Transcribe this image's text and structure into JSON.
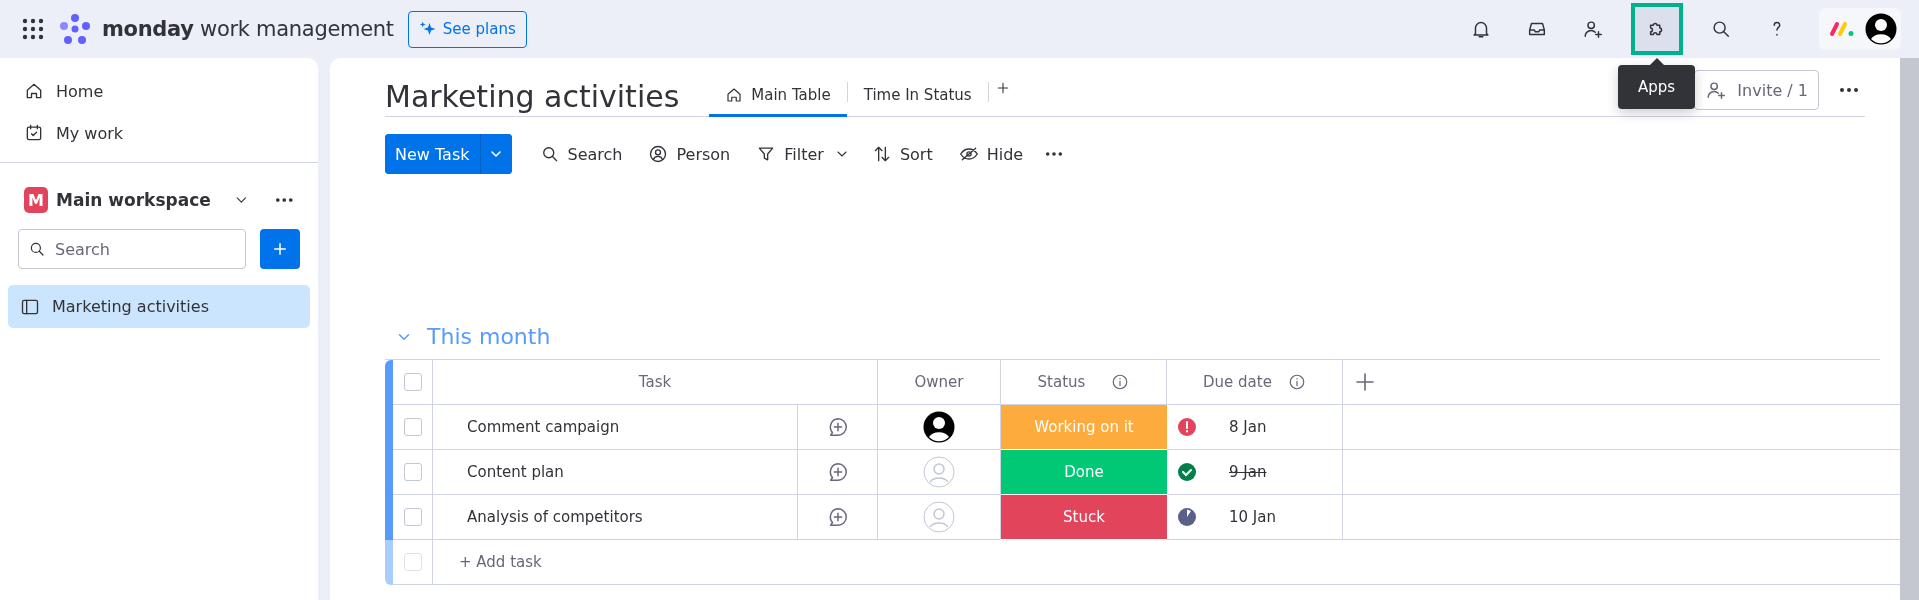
{
  "topbar": {
    "brand_bold": "monday",
    "brand_rest": "work management",
    "plans_button": "See plans",
    "icons": [
      {
        "kind": "bell",
        "selected": false
      },
      {
        "kind": "inbox",
        "selected": false
      },
      {
        "kind": "invite",
        "selected": false
      },
      {
        "kind": "apps",
        "selected": true
      },
      {
        "kind": "search",
        "selected": false
      },
      {
        "kind": "help",
        "selected": false
      }
    ],
    "tooltip": "Apps"
  },
  "sidebar": {
    "items": [
      {
        "label": "Home",
        "kind": "home"
      },
      {
        "label": "My work",
        "kind": "calendar"
      }
    ],
    "workspace": {
      "name": "Main workspace",
      "initial": "M"
    },
    "search": {
      "placeholder": "Search"
    },
    "boards": [
      {
        "label": "Marketing activities",
        "selected": true
      }
    ]
  },
  "board": {
    "title": "Marketing activities",
    "views": [
      {
        "label": "Main Table",
        "selected": true,
        "kind": "home"
      },
      {
        "label": "Time In Status",
        "selected": false,
        "kind": "plain"
      }
    ],
    "invite": "Invite / 1",
    "new_task": "New Task",
    "tools": [
      {
        "label": "Search",
        "kind": "search"
      },
      {
        "label": "Person",
        "kind": "person"
      },
      {
        "label": "Filter",
        "kind": "filter"
      },
      {
        "label": "Sort",
        "kind": "sort"
      },
      {
        "label": "Hide",
        "kind": "hide"
      }
    ],
    "group": {
      "title": "This month",
      "expanded": true,
      "select_all": {
        "checked": false
      },
      "columns": [
        "Task",
        "Owner",
        "Status",
        "Due date"
      ],
      "rows": [
        {
          "task": "Comment campaign",
          "checked": false,
          "assigned": true,
          "status": {
            "label": "Working on it",
            "color": "#fdab3d"
          },
          "due": {
            "text": "8 Jan",
            "kind": "overdue"
          }
        },
        {
          "task": "Content plan",
          "checked": false,
          "assigned": false,
          "status": {
            "label": "Done",
            "color": "#00c875"
          },
          "due": {
            "text": "9 Jan",
            "kind": "done"
          }
        },
        {
          "task": "Analysis of competitors",
          "checked": false,
          "assigned": false,
          "status": {
            "label": "Stuck",
            "color": "#e2445c"
          },
          "due": {
            "text": "10 Jan",
            "kind": "pending"
          }
        }
      ],
      "add_row": {
        "label": "+ Add task",
        "checked": false
      }
    }
  }
}
